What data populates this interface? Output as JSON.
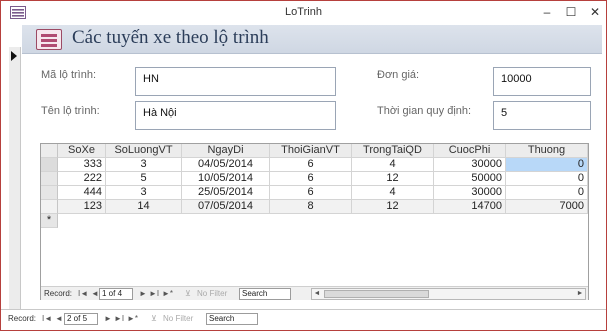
{
  "window": {
    "title": "LoTrinh",
    "min_glyph": "–",
    "max_glyph": "☐",
    "close_glyph": "✕"
  },
  "form": {
    "title": "Các tuyến xe theo lộ trình",
    "fields": {
      "ma_lo_trinh_label": "Mã lộ trình:",
      "ma_lo_trinh_value": "HN",
      "ten_lo_trinh_label": "Tên lộ trình:",
      "ten_lo_trinh_value": "Hà Nội",
      "don_gia_label": "Đơn giá:",
      "don_gia_value": "10000",
      "thoi_gian_label": "Thời gian quy định:",
      "thoi_gian_value": "5"
    }
  },
  "datasheet": {
    "columns": [
      "SoXe",
      "SoLuongVT",
      "NgayDi",
      "ThoiGianVT",
      "TrongTaiQD",
      "CuocPhi",
      "Thuong"
    ],
    "rows": [
      [
        "333",
        "3",
        "04/05/2014",
        "6",
        "4",
        "30000",
        "0"
      ],
      [
        "222",
        "5",
        "10/05/2014",
        "6",
        "12",
        "50000",
        "0"
      ],
      [
        "444",
        "3",
        "25/05/2014",
        "6",
        "4",
        "30000",
        "0"
      ],
      [
        "123",
        "14",
        "07/05/2014",
        "8",
        "12",
        "14700",
        "7000"
      ]
    ],
    "new_row_marker": "*",
    "nav": {
      "record_label": "Record:",
      "position": "1 of 4",
      "no_filter": "No Filter",
      "search": "Search"
    }
  },
  "main_nav": {
    "record_label": "Record:",
    "position": "2 of 5",
    "no_filter": "No Filter",
    "search": "Search"
  },
  "nav_glyphs": {
    "first": "I◄",
    "prev": "◄",
    "next": "►",
    "last": "►I",
    "new": "►*",
    "filter": "⊻",
    "left": "◄",
    "right": "►"
  },
  "colors": {
    "window_border": "#b6403d",
    "header_band": "#d6dde8",
    "title_text": "#2b3d59",
    "selected_cell": "#b8d8f8"
  }
}
